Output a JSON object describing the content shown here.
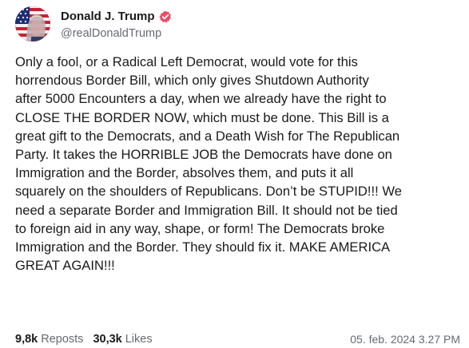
{
  "author": {
    "display_name": "Donald J. Trump",
    "handle": "@realDonaldTrump",
    "avatar_icon": "avatar-image",
    "verified_icon": "verified-badge-icon",
    "verified_color": "#ee4b6a"
  },
  "post": {
    "lines": [
      "Only a fool, or a Radical Left Democrat, would vote for this",
      "horrendous Border Bill, which only gives Shutdown Authority",
      "after 5000 Encounters a day, when we already have the right to",
      "CLOSE THE BORDER NOW, which must be done. This Bill is a",
      "great gift to the Democrats, and a Death Wish for The Republican",
      "Party. It takes the HORRIBLE JOB the Democrats have done on",
      "Immigration and the Border, absolves them, and puts it all",
      "squarely on the shoulders of Republicans. Don’t be STUPID!!! We",
      "need a separate Border and Immigration Bill. It should not be tied",
      "to foreign aid in any way, shape, or form! The Democrats broke",
      "Immigration and the Border. They should fix it. MAKE AMERICA",
      "GREAT AGAIN!!!"
    ]
  },
  "stats": {
    "reposts_count": "9,8k",
    "reposts_label": "Reposts",
    "likes_count": "30,3k",
    "likes_label": "Likes"
  },
  "timestamp": "05. feb. 2024 3.27 PM"
}
